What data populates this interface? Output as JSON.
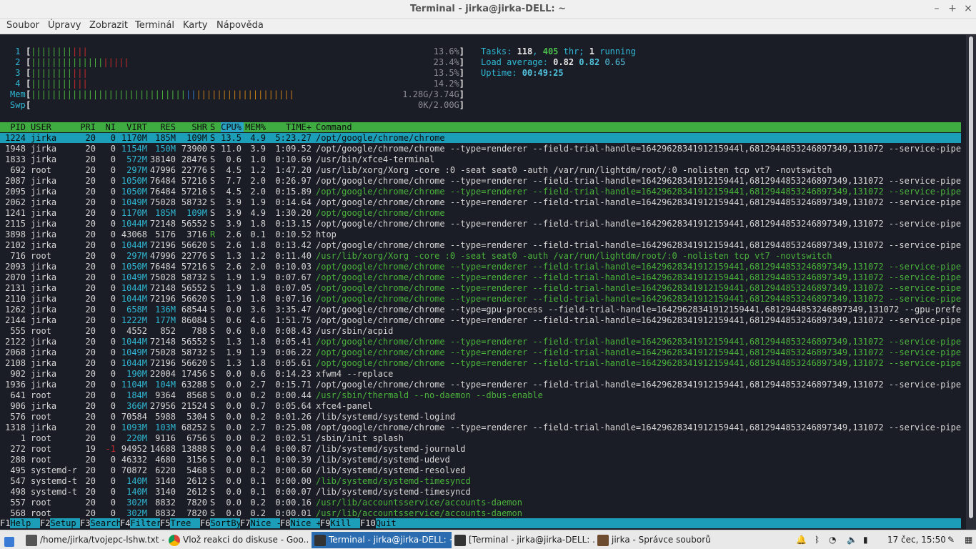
{
  "window": {
    "title": "Terminal - jirka@jirka-DELL: ~",
    "controls": [
      "–",
      "+",
      "×"
    ]
  },
  "menu": [
    "Soubor",
    "Úpravy",
    "Zobrazit",
    "Terminál",
    "Karty",
    "Nápověda"
  ],
  "meters": {
    "cpu": [
      {
        "label": "1",
        "value": "13.6%",
        "percent": 13.6
      },
      {
        "label": "2",
        "value": "23.4%",
        "percent": 23.4
      },
      {
        "label": "3",
        "value": "13.5%",
        "percent": 13.5
      },
      {
        "label": "4",
        "value": "14.2%",
        "percent": 14.2
      }
    ],
    "mem": {
      "label": "Mem",
      "value": "1.28G/3.74G"
    },
    "swp": {
      "label": "Swp",
      "value": "0K/2.00G"
    }
  },
  "summary": {
    "tasks_label": "Tasks: ",
    "tasks": "118",
    "thr": "405",
    "thr_label": " thr; ",
    "running": "1",
    "running_label": " running",
    "load_label": "Load average: ",
    "load1": "0.82",
    "load5": "0.82",
    "load15": "0.65",
    "uptime_label": "Uptime: ",
    "uptime": "00:49:25"
  },
  "columns": [
    "PID",
    "USER",
    "PRI",
    "NI",
    "VIRT",
    "RES",
    "SHR",
    "S",
    "CPU%",
    "MEM%",
    "TIME+",
    "Command"
  ],
  "processes": [
    {
      "pid": "1224",
      "user": "jirka",
      "pri": "20",
      "ni": "0",
      "virt": "1170M",
      "res": "185M",
      "shr": "109M",
      "s": "S",
      "cpu": "13.5",
      "mem": "4.9",
      "time": "5:23.27",
      "cmd": "/opt/google/chrome/chrome",
      "thread": false,
      "selected": true
    },
    {
      "pid": "1948",
      "user": "jirka",
      "pri": "20",
      "ni": "0",
      "virt": "1154M",
      "res": "150M",
      "shr": "73900",
      "s": "S",
      "cpu": "11.0",
      "mem": "3.9",
      "time": "1:09.52",
      "cmd": "/opt/google/chrome/chrome --type=renderer --field-trial-handle=1642962834191215944l,6812944853246897349,131072 --service-pipe-tok",
      "thread": false
    },
    {
      "pid": "1833",
      "user": "jirka",
      "pri": "20",
      "ni": "0",
      "virt": "572M",
      "res": "38140",
      "shr": "28476",
      "s": "S",
      "cpu": "0.6",
      "mem": "1.0",
      "time": "0:10.69",
      "cmd": "/usr/bin/xfce4-terminal",
      "thread": false
    },
    {
      "pid": "692",
      "user": "root",
      "pri": "20",
      "ni": "0",
      "virt": "297M",
      "res": "47996",
      "shr": "22776",
      "s": "S",
      "cpu": "4.5",
      "mem": "1.2",
      "time": "1:47.20",
      "cmd": "/usr/lib/xorg/Xorg -core :0 -seat seat0 -auth /var/run/lightdm/root/:0 -nolisten tcp vt7 -novtswitch",
      "thread": false
    },
    {
      "pid": "2087",
      "user": "jirka",
      "pri": "20",
      "ni": "0",
      "virt": "1050M",
      "res": "76484",
      "shr": "57216",
      "s": "S",
      "cpu": "7.7",
      "mem": "2.0",
      "time": "0:26.97",
      "cmd": "/opt/google/chrome/chrome --type=renderer --field-trial-handle=16429628341912159441,6812944853246897349,131072 --service-pipe-tok",
      "thread": false
    },
    {
      "pid": "2095",
      "user": "jirka",
      "pri": "20",
      "ni": "0",
      "virt": "1050M",
      "res": "76484",
      "shr": "57216",
      "s": "S",
      "cpu": "4.5",
      "mem": "2.0",
      "time": "0:15.89",
      "cmd": "/opt/google/chrome/chrome --type=renderer --field-trial-handle=16429628341912159441,6812944853246897349,131072 --service-pipe-tok",
      "thread": true
    },
    {
      "pid": "2062",
      "user": "jirka",
      "pri": "20",
      "ni": "0",
      "virt": "1049M",
      "res": "75028",
      "shr": "58732",
      "s": "S",
      "cpu": "3.9",
      "mem": "1.9",
      "time": "0:14.64",
      "cmd": "/opt/google/chrome/chrome --type=renderer --field-trial-handle=16429628341912159441,6812944853246897349,131072 --service-pipe-tok",
      "thread": false
    },
    {
      "pid": "1241",
      "user": "jirka",
      "pri": "20",
      "ni": "0",
      "virt": "1170M",
      "res": "185M",
      "shr": "109M",
      "s": "S",
      "cpu": "3.9",
      "mem": "4.9",
      "time": "1:30.20",
      "cmd": "/opt/google/chrome/chrome",
      "thread": true
    },
    {
      "pid": "2115",
      "user": "jirka",
      "pri": "20",
      "ni": "0",
      "virt": "1044M",
      "res": "72148",
      "shr": "56552",
      "s": "S",
      "cpu": "3.9",
      "mem": "1.8",
      "time": "0:13.15",
      "cmd": "/opt/google/chrome/chrome --type=renderer --field-trial-handle=16429628341912159441,6812944853246897349,131072 --service-pipe-tok",
      "thread": false
    },
    {
      "pid": "3898",
      "user": "jirka",
      "pri": "20",
      "ni": "0",
      "virt": "43068",
      "res": "5176",
      "shr": "3716",
      "s": "R",
      "cpu": "2.6",
      "mem": "0.1",
      "time": "0:10.52",
      "cmd": "htop",
      "thread": false
    },
    {
      "pid": "2102",
      "user": "jirka",
      "pri": "20",
      "ni": "0",
      "virt": "1044M",
      "res": "72196",
      "shr": "56620",
      "s": "S",
      "cpu": "2.6",
      "mem": "1.8",
      "time": "0:13.42",
      "cmd": "/opt/google/chrome/chrome --type=renderer --field-trial-handle=16429628341912159441,6812944853246897349,131072 --service-pipe-tok",
      "thread": false
    },
    {
      "pid": "716",
      "user": "root",
      "pri": "20",
      "ni": "0",
      "virt": "297M",
      "res": "47996",
      "shr": "22776",
      "s": "S",
      "cpu": "1.3",
      "mem": "1.2",
      "time": "0:11.40",
      "cmd": "/usr/lib/xorg/Xorg -core :0 -seat seat0 -auth /var/run/lightdm/root/:0 -nolisten tcp vt7 -novtswitch",
      "thread": true
    },
    {
      "pid": "2093",
      "user": "jirka",
      "pri": "20",
      "ni": "0",
      "virt": "1050M",
      "res": "76484",
      "shr": "57216",
      "s": "S",
      "cpu": "2.6",
      "mem": "2.0",
      "time": "0:10.03",
      "cmd": "/opt/google/chrome/chrome --type=renderer --field-trial-handle=16429628341912159441,6812944853246897349,131072 --service-pipe-tok",
      "thread": true
    },
    {
      "pid": "2070",
      "user": "jirka",
      "pri": "20",
      "ni": "0",
      "virt": "1049M",
      "res": "75028",
      "shr": "58732",
      "s": "S",
      "cpu": "1.9",
      "mem": "1.9",
      "time": "0:07.67",
      "cmd": "/opt/google/chrome/chrome --type=renderer --field-trial-handle=16429628341912159441,6812944853246897349,131072 --service-pipe-tok",
      "thread": true
    },
    {
      "pid": "2131",
      "user": "jirka",
      "pri": "20",
      "ni": "0",
      "virt": "1044M",
      "res": "72148",
      "shr": "56552",
      "s": "S",
      "cpu": "1.9",
      "mem": "1.8",
      "time": "0:07.05",
      "cmd": "/opt/google/chrome/chrome --type=renderer --field-trial-handle=16429628341912159441,6812944853246897349,131072 --service-pipe-tok",
      "thread": true
    },
    {
      "pid": "2110",
      "user": "jirka",
      "pri": "20",
      "ni": "0",
      "virt": "1044M",
      "res": "72196",
      "shr": "56620",
      "s": "S",
      "cpu": "1.9",
      "mem": "1.8",
      "time": "0:07.16",
      "cmd": "/opt/google/chrome/chrome --type=renderer --field-trial-handle=16429628341912159441,6812944853246897349,131072 --service-pipe-tok",
      "thread": true
    },
    {
      "pid": "1262",
      "user": "jirka",
      "pri": "20",
      "ni": "0",
      "virt": "658M",
      "res": "136M",
      "shr": "68544",
      "s": "S",
      "cpu": "0.0",
      "mem": "3.6",
      "time": "3:35.47",
      "cmd": "/opt/google/chrome/chrome --type=gpu-process --field-trial-handle=16429628341912159441,6812944853246897349,131072 --gpu-preferenc",
      "thread": false
    },
    {
      "pid": "2144",
      "user": "jirka",
      "pri": "20",
      "ni": "0",
      "virt": "1222M",
      "res": "177M",
      "shr": "86084",
      "s": "S",
      "cpu": "0.6",
      "mem": "4.6",
      "time": "1:51.75",
      "cmd": "/opt/google/chrome/chrome --type=renderer --field-trial-handle=16429628341912159441,6812944853246897349,131072 --service-pipe-tok",
      "thread": false
    },
    {
      "pid": "555",
      "user": "root",
      "pri": "20",
      "ni": "0",
      "virt": "4552",
      "res": "852",
      "shr": "788",
      "s": "S",
      "cpu": "0.6",
      "mem": "0.0",
      "time": "0:08.43",
      "cmd": "/usr/sbin/acpid",
      "thread": false
    },
    {
      "pid": "2122",
      "user": "jirka",
      "pri": "20",
      "ni": "0",
      "virt": "1044M",
      "res": "72148",
      "shr": "56552",
      "s": "S",
      "cpu": "1.3",
      "mem": "1.8",
      "time": "0:05.41",
      "cmd": "/opt/google/chrome/chrome --type=renderer --field-trial-handle=16429628341912159441,6812944853246897349,131072 --service-pipe-tok",
      "thread": true
    },
    {
      "pid": "2068",
      "user": "jirka",
      "pri": "20",
      "ni": "0",
      "virt": "1049M",
      "res": "75028",
      "shr": "58732",
      "s": "S",
      "cpu": "1.9",
      "mem": "1.9",
      "time": "0:06.22",
      "cmd": "/opt/google/chrome/chrome --type=renderer --field-trial-handle=16429628341912159441,6812944853246897349,131072 --service-pipe-tok",
      "thread": true
    },
    {
      "pid": "2108",
      "user": "jirka",
      "pri": "20",
      "ni": "0",
      "virt": "1044M",
      "res": "72196",
      "shr": "56620",
      "s": "S",
      "cpu": "1.3",
      "mem": "1.8",
      "time": "0:05.61",
      "cmd": "/opt/google/chrome/chrome --type=renderer --field-trial-handle=16429628341912159441,6812944853246897349,131072 --service-pipe-tok",
      "thread": true
    },
    {
      "pid": "902",
      "user": "jirka",
      "pri": "20",
      "ni": "0",
      "virt": "190M",
      "res": "22004",
      "shr": "17456",
      "s": "S",
      "cpu": "0.0",
      "mem": "0.6",
      "time": "0:14.23",
      "cmd": "xfwm4 --replace",
      "thread": false
    },
    {
      "pid": "1936",
      "user": "jirka",
      "pri": "20",
      "ni": "0",
      "virt": "1104M",
      "res": "104M",
      "shr": "63288",
      "s": "S",
      "cpu": "0.0",
      "mem": "2.7",
      "time": "0:15.71",
      "cmd": "/opt/google/chrome/chrome --type=renderer --field-trial-handle=16429628341912159441,6812944853246897349,131072 --service-pipe-tok",
      "thread": false
    },
    {
      "pid": "641",
      "user": "root",
      "pri": "20",
      "ni": "0",
      "virt": "184M",
      "res": "9364",
      "shr": "8568",
      "s": "S",
      "cpu": "0.0",
      "mem": "0.2",
      "time": "0:00.44",
      "cmd": "/usr/sbin/thermald --no-daemon --dbus-enable",
      "thread": true
    },
    {
      "pid": "906",
      "user": "jirka",
      "pri": "20",
      "ni": "0",
      "virt": "366M",
      "res": "27956",
      "shr": "21524",
      "s": "S",
      "cpu": "0.0",
      "mem": "0.7",
      "time": "0:05.64",
      "cmd": "xfce4-panel",
      "thread": false
    },
    {
      "pid": "576",
      "user": "root",
      "pri": "20",
      "ni": "0",
      "virt": "70584",
      "res": "5988",
      "shr": "5304",
      "s": "S",
      "cpu": "0.0",
      "mem": "0.2",
      "time": "0:01.26",
      "cmd": "/lib/systemd/systemd-logind",
      "thread": false
    },
    {
      "pid": "1318",
      "user": "jirka",
      "pri": "20",
      "ni": "0",
      "virt": "1093M",
      "res": "103M",
      "shr": "68252",
      "s": "S",
      "cpu": "0.0",
      "mem": "2.7",
      "time": "0:25.08",
      "cmd": "/opt/google/chrome/chrome --type=renderer --field-trial-handle=16429628341912159441,6812944853246897349,131072 --service-pipe-tok",
      "thread": false
    },
    {
      "pid": "1",
      "user": "root",
      "pri": "20",
      "ni": "0",
      "virt": "220M",
      "res": "9116",
      "shr": "6756",
      "s": "S",
      "cpu": "0.0",
      "mem": "0.2",
      "time": "0:02.51",
      "cmd": "/sbin/init splash",
      "thread": false
    },
    {
      "pid": "272",
      "user": "root",
      "pri": "19",
      "ni": "-1",
      "virt": "94952",
      "res": "14688",
      "shr": "13888",
      "s": "S",
      "cpu": "0.0",
      "mem": "0.4",
      "time": "0:00.87",
      "cmd": "/lib/systemd/systemd-journald",
      "thread": false
    },
    {
      "pid": "288",
      "user": "root",
      "pri": "20",
      "ni": "0",
      "virt": "46332",
      "res": "4680",
      "shr": "3156",
      "s": "S",
      "cpu": "0.0",
      "mem": "0.1",
      "time": "0:00.39",
      "cmd": "/lib/systemd/systemd-udevd",
      "thread": false
    },
    {
      "pid": "495",
      "user": "systemd-r",
      "pri": "20",
      "ni": "0",
      "virt": "70872",
      "res": "6220",
      "shr": "5468",
      "s": "S",
      "cpu": "0.0",
      "mem": "0.2",
      "time": "0:00.60",
      "cmd": "/lib/systemd/systemd-resolved",
      "thread": false
    },
    {
      "pid": "547",
      "user": "systemd-t",
      "pri": "20",
      "ni": "0",
      "virt": "140M",
      "res": "3140",
      "shr": "2612",
      "s": "S",
      "cpu": "0.0",
      "mem": "0.1",
      "time": "0:00.00",
      "cmd": "/lib/systemd/systemd-timesyncd",
      "thread": true
    },
    {
      "pid": "498",
      "user": "systemd-t",
      "pri": "20",
      "ni": "0",
      "virt": "140M",
      "res": "3140",
      "shr": "2612",
      "s": "S",
      "cpu": "0.0",
      "mem": "0.1",
      "time": "0:00.07",
      "cmd": "/lib/systemd/systemd-timesyncd",
      "thread": false
    },
    {
      "pid": "557",
      "user": "root",
      "pri": "20",
      "ni": "0",
      "virt": "302M",
      "res": "8832",
      "shr": "7820",
      "s": "S",
      "cpu": "0.0",
      "mem": "0.2",
      "time": "0:00.16",
      "cmd": "/usr/lib/accountsservice/accounts-daemon",
      "thread": true
    },
    {
      "pid": "568",
      "user": "root",
      "pri": "20",
      "ni": "0",
      "virt": "302M",
      "res": "8832",
      "shr": "7820",
      "s": "S",
      "cpu": "0.0",
      "mem": "0.2",
      "time": "0:00.01",
      "cmd": "/usr/lib/accountsservice/accounts-daemon",
      "thread": true
    }
  ],
  "fkeys": [
    {
      "key": "F1",
      "label": "Help"
    },
    {
      "key": "F2",
      "label": "Setup"
    },
    {
      "key": "F3",
      "label": "Search"
    },
    {
      "key": "F4",
      "label": "Filter"
    },
    {
      "key": "F5",
      "label": "Tree"
    },
    {
      "key": "F6",
      "label": "SortBy"
    },
    {
      "key": "F7",
      "label": "Nice -"
    },
    {
      "key": "F8",
      "label": "Nice +"
    },
    {
      "key": "F9",
      "label": "Kill"
    },
    {
      "key": "F10",
      "label": "Quit"
    }
  ],
  "taskbar": {
    "tasks": [
      {
        "icon": "text-editor-icon",
        "label": "/home/jirka/tvojepc-lshw.txt -...",
        "active": false
      },
      {
        "icon": "chrome-icon",
        "label": "Vlož reakci do diskuse - Goo...",
        "active": false
      },
      {
        "icon": "terminal-icon",
        "label": "Terminal - jirka@jirka-DELL: ~",
        "active": true
      },
      {
        "icon": "terminal-icon",
        "label": "[Terminal - jirka@jirka-DELL: ...",
        "active": false
      },
      {
        "icon": "home-folder-icon",
        "label": "jirka - Správce souborů",
        "active": false
      }
    ],
    "clock": "17 čec, 15:50"
  },
  "colors": {
    "bg": "#1b1d26",
    "cyan": "#2fb7d3",
    "green": "#4ab23b",
    "red": "#c42a2a",
    "header_green": "#3fac41",
    "select_cyan": "#1c9eb8",
    "taskbar_active": "#2b6cb0"
  }
}
